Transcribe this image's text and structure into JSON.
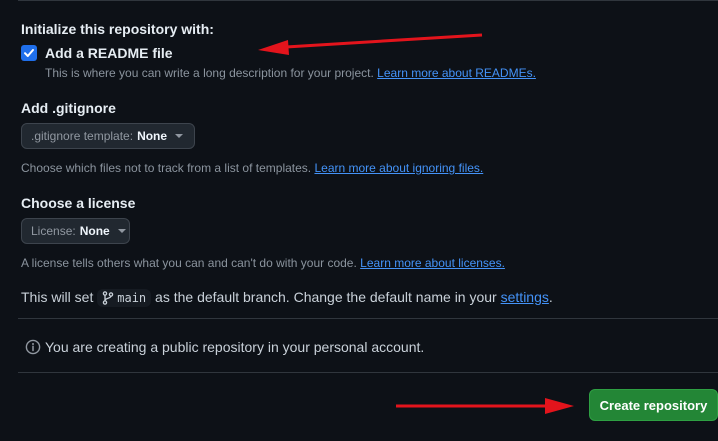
{
  "init": {
    "heading": "Initialize this repository with:",
    "readme_label": "Add a README file",
    "readme_checked": true,
    "readme_desc": "This is where you can write a long description for your project.",
    "readme_link": "Learn more about READMEs."
  },
  "gitignore": {
    "heading": "Add .gitignore",
    "dropdown_label": ".gitignore template:",
    "dropdown_value": "None",
    "desc": "Choose which files not to track from a list of templates.",
    "link": "Learn more about ignoring files."
  },
  "license": {
    "heading": "Choose a license",
    "dropdown_label": "License:",
    "dropdown_value": "None",
    "desc": "A license tells others what you can and can't do with your code.",
    "link": "Learn more about licenses."
  },
  "branch": {
    "text_before": "This will set",
    "branch_name": "main",
    "text_after": "as the default branch. Change the default name in your",
    "settings_link": "settings",
    "text_end": "."
  },
  "info": {
    "text": "You are creating a public repository in your personal account."
  },
  "actions": {
    "create_label": "Create repository"
  },
  "colors": {
    "accent": "#1f6feb",
    "link": "#4493f8",
    "create_button": "#238636",
    "arrow": "#e3141c",
    "background": "#0d1117"
  }
}
